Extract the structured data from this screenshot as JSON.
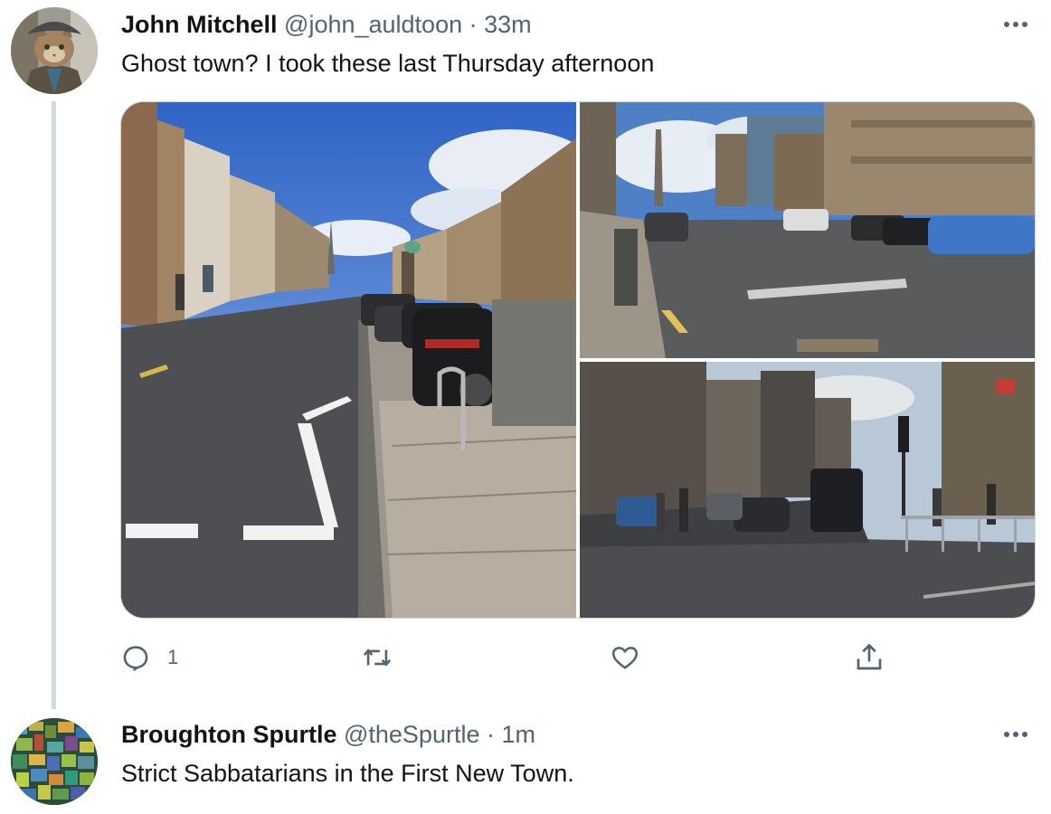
{
  "tweets": [
    {
      "author_name": "John Mitchell",
      "handle": "@john_auldtoon",
      "separator": "·",
      "time": "33m",
      "text": "Ghost town? I took these last Thursday afternoon",
      "avatar_icon": "cat-in-flat-cap-avatar",
      "more_icon": "more-horizontal-icon",
      "media": [
        {
          "description_icon": "street-photo-parked-cars"
        },
        {
          "description_icon": "street-photo-no-entry-road"
        },
        {
          "description_icon": "street-photo-traffic-junction"
        }
      ],
      "actions": {
        "reply_count": "1",
        "retweet_count": "",
        "like_count": ""
      }
    },
    {
      "author_name": "Broughton Spurtle",
      "handle": "@theSpurtle",
      "separator": "·",
      "time": "1m",
      "text": "Strict Sabbatarians in the First New Town.",
      "avatar_icon": "mosaic-avatar",
      "more_icon": "more-horizontal-icon"
    }
  ],
  "colors": {
    "text_primary": "#0f1419",
    "text_secondary": "#536471",
    "border": "#cfd9de"
  }
}
